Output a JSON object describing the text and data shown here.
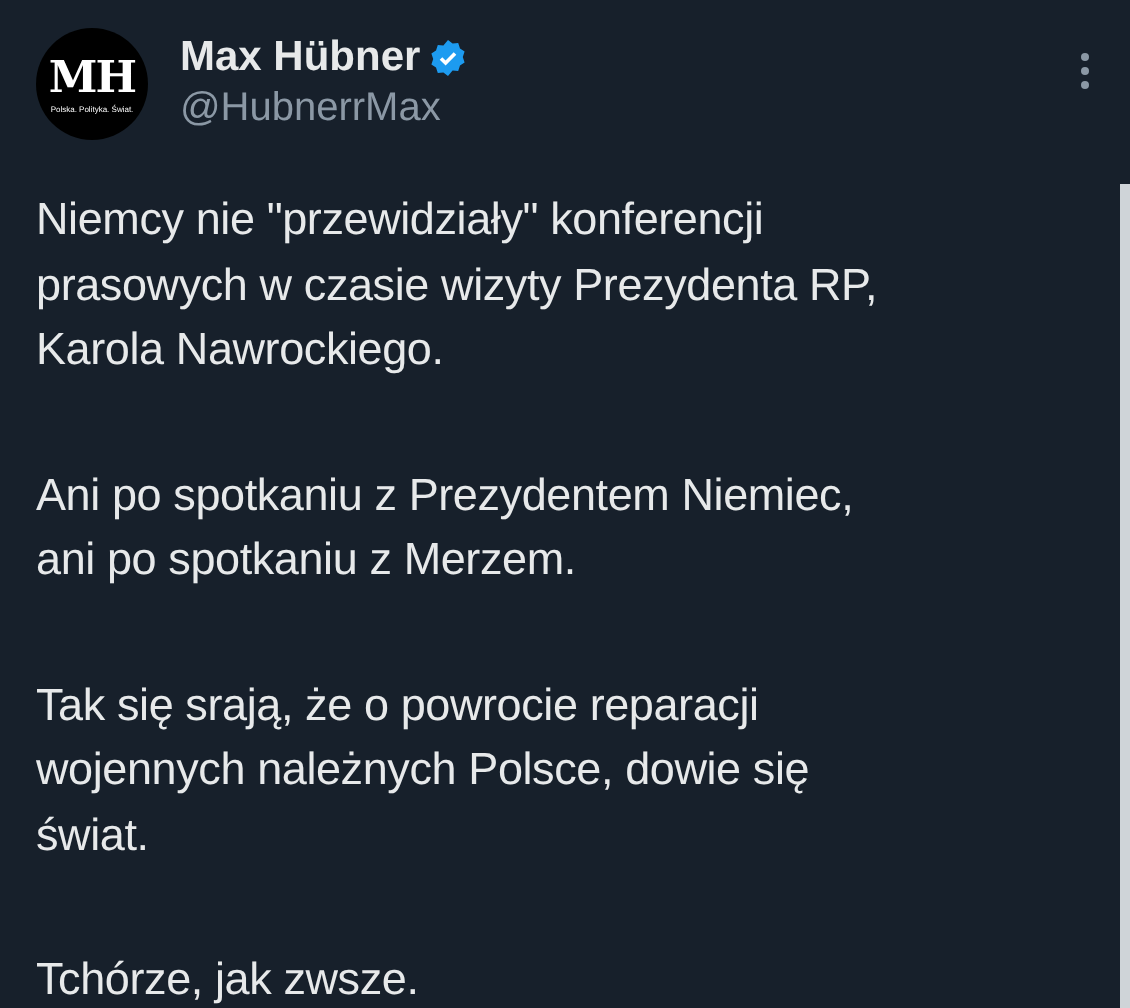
{
  "author": {
    "avatar_initials": "MH",
    "avatar_caption": "Polska. Polityka. Świat.",
    "name": "Max Hübner",
    "verified": true,
    "handle": "@HubnerrMax"
  },
  "paragraphs": [
    [
      "Niemcy nie \"przewidziały\" konferencji",
      "prasowych w czasie wizyty Prezydenta RP,",
      "Karola Nawrockiego."
    ],
    [
      "Ani po spotkaniu z Prezydentem Niemiec,",
      "ani po spotkaniu z Merzem."
    ],
    [
      "Tak się srają, że o powrocie reparacji",
      "wojennych należnych Polsce, dowie się",
      "świat."
    ],
    [
      "Tchórze, jak zwsze."
    ]
  ]
}
